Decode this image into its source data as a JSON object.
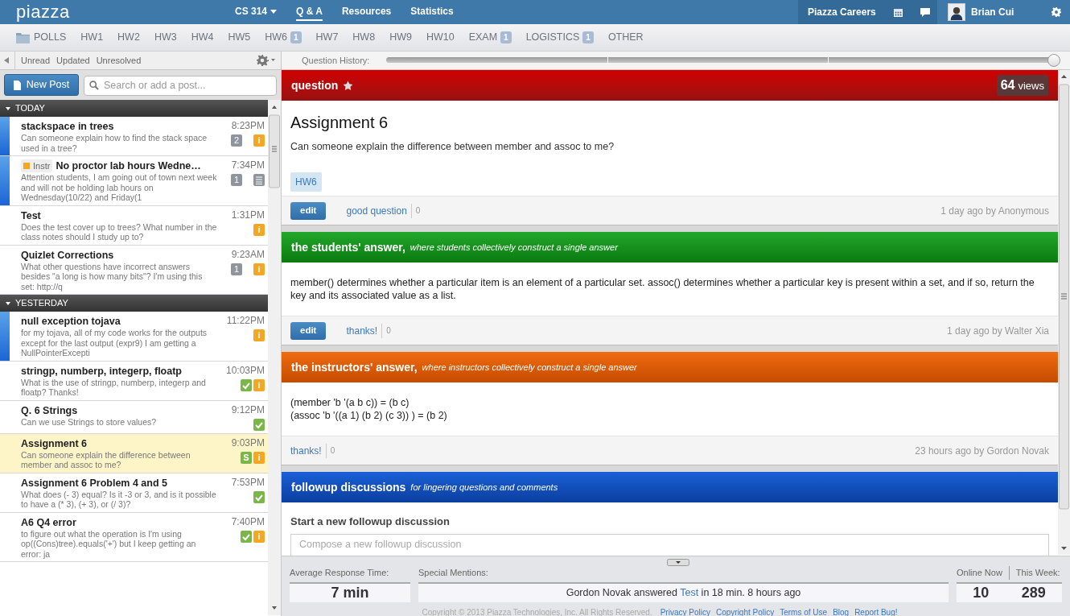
{
  "topbar": {
    "logo": "piazza",
    "nav": [
      {
        "label": "CS 314",
        "kind": "dropdown",
        "selected": false
      },
      {
        "label": "Q & A",
        "kind": "link",
        "selected": true
      },
      {
        "label": "Resources",
        "kind": "link",
        "selected": false
      },
      {
        "label": "Statistics",
        "kind": "link",
        "selected": false
      }
    ],
    "careers": "Piazza Careers",
    "user": "Brian Cui"
  },
  "folders": [
    {
      "label": "POLLS"
    },
    {
      "label": "HW1"
    },
    {
      "label": "HW2"
    },
    {
      "label": "HW3"
    },
    {
      "label": "HW4"
    },
    {
      "label": "HW5"
    },
    {
      "label": "HW6",
      "count": "1"
    },
    {
      "label": "HW7"
    },
    {
      "label": "HW8"
    },
    {
      "label": "HW9"
    },
    {
      "label": "HW10"
    },
    {
      "label": "EXAM",
      "count": "1"
    },
    {
      "label": "LOGISTICS",
      "count": "1"
    },
    {
      "label": "OTHER"
    }
  ],
  "filters": [
    "Unread",
    "Updated",
    "Unresolved"
  ],
  "history": {
    "label": "Question History:",
    "level": 1
  },
  "new_post": "New Post",
  "search": {
    "placeholder": "Search or add a post..."
  },
  "groups": [
    {
      "title": "TODAY",
      "posts": [
        {
          "title": "stackspace in trees",
          "preview": "Can someone explain how to find the stack space used in a tree?",
          "time": "8:23PM",
          "unread": true,
          "selected": false,
          "badges": [
            {
              "kind": "count",
              "text": "2"
            },
            {
              "kind": "unanswered",
              "text": "i"
            }
          ]
        },
        {
          "tag": "Instr",
          "title": "No proctor lab hours Wedne…",
          "preview": "Attention students, I am going out of town next week and will not be holding lab hours on Wednesday(10/22) and Friday(1",
          "time": "7:34PM",
          "unread": true,
          "selected": false,
          "badges": [
            {
              "kind": "count",
              "text": "1"
            },
            {
              "kind": "note"
            }
          ]
        },
        {
          "title": "Test",
          "preview": "Does the test cover up to trees? What number in the class notes should I study up to?",
          "time": "1:31PM",
          "unread": false,
          "selected": false,
          "badges": [
            {
              "kind": "unanswered",
              "text": "i"
            }
          ]
        },
        {
          "title": "Quizlet Corrections",
          "preview": "What other questions have incorrect answers besides \"a long is how many bits\"? I'm using this set: http://q",
          "time": "9:23AM",
          "unread": false,
          "selected": false,
          "badges": [
            {
              "kind": "count",
              "text": "1"
            },
            {
              "kind": "unanswered",
              "text": "i"
            }
          ]
        }
      ]
    },
    {
      "title": "YESTERDAY",
      "posts": [
        {
          "title": "null exception tojava",
          "preview": "for my tojava, all of my code works for the outputs except for the last output (expr9) I am getting a NullPointerExcepti",
          "time": "11:22PM",
          "unread": true,
          "selected": false,
          "badges": [
            {
              "kind": "unanswered",
              "text": "i"
            }
          ]
        },
        {
          "title": "stringp, numberp, integerp, floatp",
          "preview": "What is the use of stringp, numberp, integerp and floatp? Thanks!",
          "time": "10:03PM",
          "unread": false,
          "selected": false,
          "badges": [
            {
              "kind": "good"
            },
            {
              "kind": "unanswered",
              "text": "i"
            }
          ]
        },
        {
          "title": "Q. 6 Strings",
          "preview": "Can we use Strings to store values?",
          "time": "9:12PM",
          "unread": false,
          "selected": false,
          "badges": [
            {
              "kind": "good"
            }
          ]
        },
        {
          "title": "Assignment 6",
          "preview": "Can someone explain the difference between member and assoc to me?",
          "time": "9:03PM",
          "unread": false,
          "selected": true,
          "badges": [
            {
              "kind": "students",
              "text": "S"
            },
            {
              "kind": "unanswered",
              "text": "i"
            }
          ]
        },
        {
          "title": "Assignment 6 Problem 4 and 5",
          "preview": "What does (- 3) equal? Is it -3 or 3, and is it possible to have  a (* 3), (+ 3), or (/ 3)?",
          "time": "7:53PM",
          "unread": false,
          "selected": false,
          "badges": [
            {
              "kind": "good"
            }
          ]
        },
        {
          "title": "A6 Q4 error",
          "preview": "to figure out what the operation is I'm using op((Cons)tree).equals('+') but I keep getting an error: ja",
          "time": "7:40PM",
          "unread": false,
          "selected": false,
          "badges": [
            {
              "kind": "good"
            },
            {
              "kind": "unanswered",
              "text": "i"
            }
          ]
        }
      ]
    }
  ],
  "question": {
    "header": "question",
    "starred": false,
    "views_count": "64",
    "views_label": "views",
    "title": "Assignment 6",
    "body": "Can someone explain the difference between member and assoc to me?",
    "tags": [
      "HW6"
    ],
    "edit": "edit",
    "good": "good question",
    "good_count": "0",
    "meta": "1 day ago by Anonymous"
  },
  "answers": [
    {
      "kind": "students",
      "header": "the students' answer,",
      "subtitle": "where students collectively construct a single answer",
      "lines": [
        "member() determines whether a particular item is an element of a particular set. assoc() determines whether a particular key is present within a set, and if so, return the key and its associated value as a list."
      ],
      "edit": "edit",
      "thanks": "thanks!",
      "thanks_count": "0",
      "meta": "1 day ago by Walter Xia"
    },
    {
      "kind": "instructors",
      "header": "the instructors' answer,",
      "subtitle": "where instructors collectively construct a single answer",
      "lines": [
        "(member 'b '(a b c))  =  (b c)",
        "(assoc 'b '((a 1) (b 2) (c 3)) )  =  (b 2)"
      ],
      "thanks": "thanks!",
      "thanks_count": "0",
      "meta": "23 hours ago by Gordon Novak"
    }
  ],
  "followup": {
    "header": "followup discussions",
    "subtitle": "for lingering questions and comments",
    "start": "Start a new followup discussion",
    "placeholder": "Compose a new followup discussion"
  },
  "stats": {
    "avg_label": "Average Response Time:",
    "avg": "7 min",
    "mentions_label": "Special Mentions:",
    "mention_before": "Gordon Novak answered",
    "mention_link": "Test",
    "mention_after": "in 18 min. 8 hours ago",
    "online_label": "Online Now",
    "week_label": "This Week:",
    "online": "10",
    "week": "289"
  },
  "footer": {
    "copyright": "Copyright © 2013 Piazza Technologies, Inc. All Rights Reserved.",
    "links": [
      "Privacy Policy",
      "Copyright Policy",
      "Terms of Use",
      "Blog",
      "Report Bug!"
    ]
  }
}
